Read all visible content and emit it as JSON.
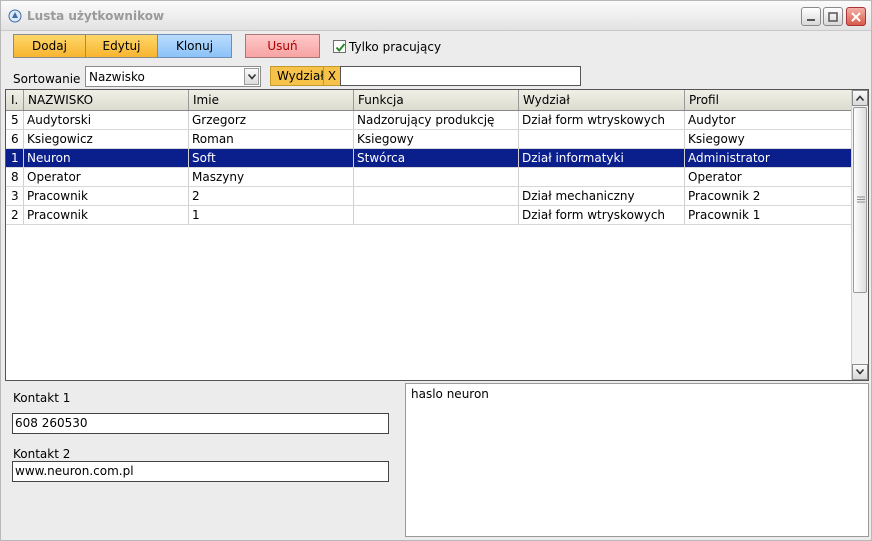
{
  "window": {
    "title": "Lusta użytkownikow"
  },
  "toolbar": {
    "add_label": "Dodaj",
    "edit_label": "Edytuj",
    "clone_label": "Klonuj",
    "delete_label": "Usuń",
    "only_employed_label": "Tylko pracujący",
    "only_employed_checked": true
  },
  "sort": {
    "label": "Sortowanie",
    "selected": "Nazwisko"
  },
  "filter": {
    "tag_label": "Wydział",
    "clear_label": "X",
    "value": ""
  },
  "table": {
    "columns": [
      "I.",
      "NAZWISKO",
      "Imie",
      "Funkcja",
      "Wydział",
      "Profil"
    ],
    "rows": [
      [
        "5",
        "Audytorski",
        "Grzegorz",
        "Nadzorujący produkcję",
        "Dział form wtryskowych",
        "Audytor"
      ],
      [
        "6",
        "Ksiegowicz",
        "Roman",
        "Ksiegowy",
        "",
        "Ksiegowy"
      ],
      [
        "1",
        "Neuron",
        "Soft",
        "Stwórca",
        "Dział informatyki",
        "Administrator"
      ],
      [
        "8",
        "Operator",
        "Maszyny",
        "",
        "",
        "Operator"
      ],
      [
        "3",
        "Pracownik",
        "2",
        "",
        "Dział mechaniczny",
        "Pracownik 2"
      ],
      [
        "2",
        "Pracownik",
        "1",
        "",
        "Dział form wtryskowych",
        "Pracownik 1"
      ]
    ],
    "selected_row": 2
  },
  "details": {
    "contact1_label": "Kontakt 1",
    "contact1_value": "608 260530",
    "contact2_label": "Kontakt 2",
    "contact2_value": "www.neuron.com.pl",
    "notes": "haslo neuron"
  },
  "colors": {
    "selection": "#0a1e8c",
    "button_orange": "#f7b52e",
    "button_blue": "#8cc2f7",
    "button_red": "#f7a3a3"
  }
}
